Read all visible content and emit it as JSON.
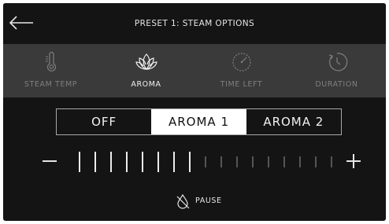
{
  "header": {
    "title": "PRESET 1: STEAM OPTIONS",
    "back_icon": "arrow-left-icon"
  },
  "tabs": [
    {
      "label": "STEAM TEMP",
      "icon": "thermometer-icon",
      "active": false
    },
    {
      "label": "AROMA",
      "icon": "lotus-icon",
      "active": true
    },
    {
      "label": "TIME LEFT",
      "icon": "timer-dial-icon",
      "active": false
    },
    {
      "label": "DURATION",
      "icon": "clock-refresh-icon",
      "active": false
    }
  ],
  "aroma_options": [
    {
      "label": "OFF",
      "selected": false
    },
    {
      "label": "AROMA 1",
      "selected": true
    },
    {
      "label": "AROMA 2",
      "selected": false
    }
  ],
  "slider": {
    "level": 8,
    "total": 17
  },
  "pause": {
    "label": "PAUSE",
    "icon": "pause-drop-icon"
  },
  "colors": {
    "background": "#141414",
    "tab_bar": "#3a3a3a",
    "active": "#ffffff",
    "inactive": "#7f7f7f"
  }
}
